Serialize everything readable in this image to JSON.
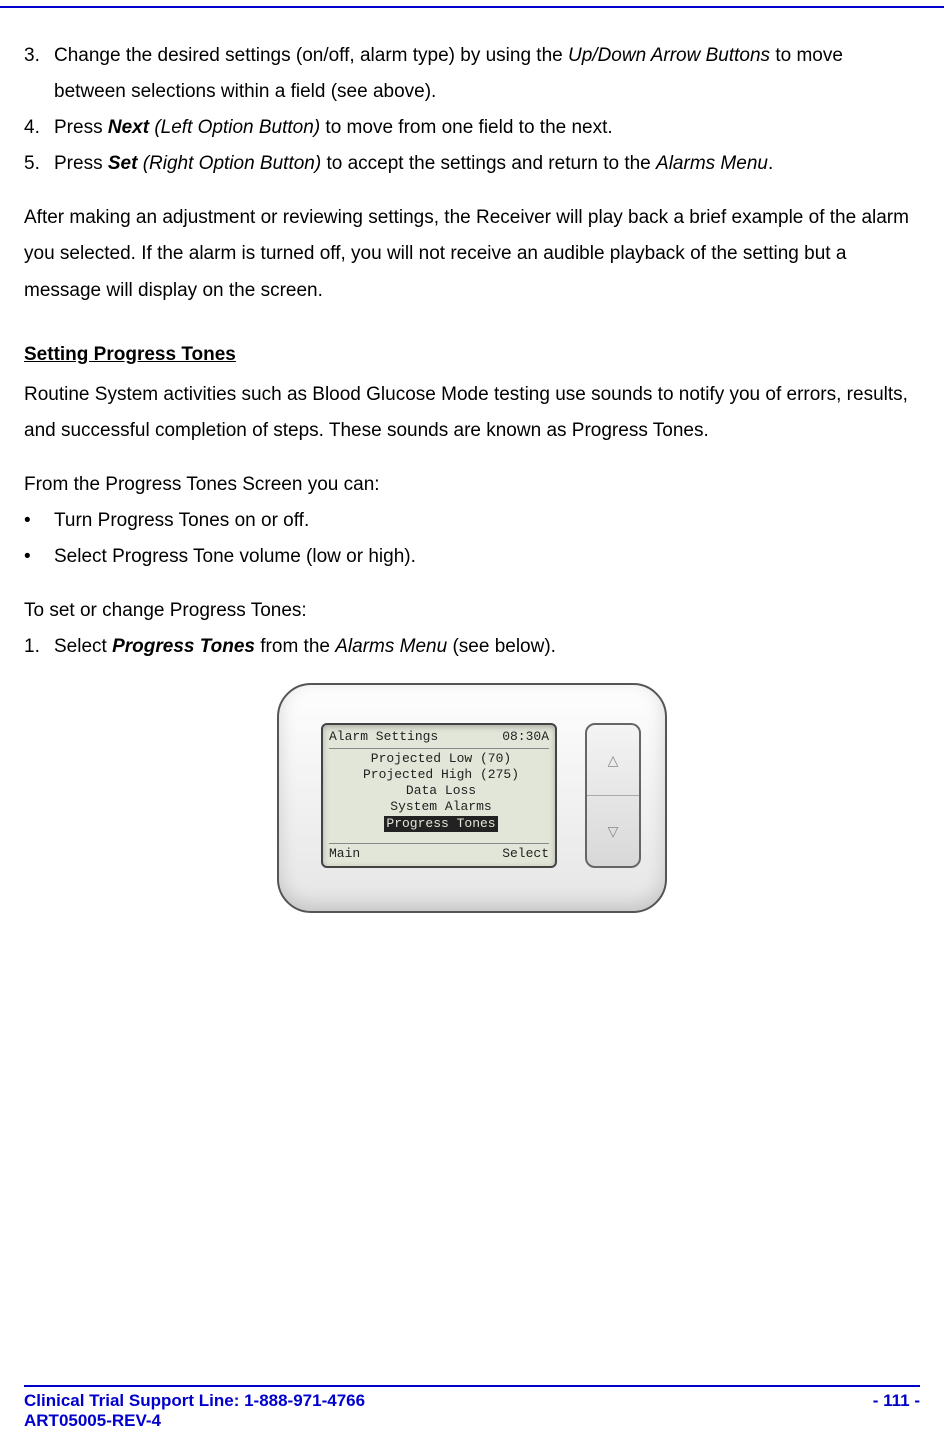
{
  "steps_a": {
    "n3": "3.",
    "n4": "4.",
    "n5": "5.",
    "s3_p1": "Change the desired settings (on/off, alarm type) by using the ",
    "s3_i1": "Up/Down Arrow Buttons",
    "s3_p2": " to move between selections within a field (see above).",
    "s4_p1": "Press ",
    "s4_b1": "Next",
    "s4_i1": " (Left Option Button)",
    "s4_p2": " to move from one field to the next.",
    "s5_p1": "Press ",
    "s5_b1": "Set",
    "s5_i1": " (Right Option Button)",
    "s5_p2": " to accept the settings and return to the ",
    "s5_i2": "Alarms Menu",
    "s5_p3": "."
  },
  "para1": "After making an adjustment or reviewing settings, the Receiver will play back a brief example of the alarm you selected. If the alarm is turned off, you will not receive an audible playback of the setting but a message will display on the screen.",
  "heading": "Setting Progress Tones",
  "para2": "Routine System activities such as Blood Glucose Mode testing use sounds to notify you of errors, results, and successful completion of steps. These sounds are known as Progress Tones.",
  "lead2": "From the Progress Tones Screen you can:",
  "bullet_mark": "•",
  "bullets": {
    "b1": "Turn Progress Tones on or off.",
    "b2": "Select Progress Tone volume (low or high)."
  },
  "lead3": "To set or change Progress Tones:",
  "steps_b": {
    "n1": "1.",
    "s1_p1": "Select ",
    "s1_b1": "Progress Tones",
    "s1_p2": " from the ",
    "s1_i1": "Alarms Menu",
    "s1_p3": " (see below)."
  },
  "device": {
    "screen_title": "Alarm Settings",
    "screen_time": "08:30A",
    "items": {
      "i1": "Projected Low (70)",
      "i2": "Projected High (275)",
      "i3": "Data Loss",
      "i4": "System Alarms",
      "i5": "Progress Tones"
    },
    "soft_left": "Main",
    "soft_right": "Select",
    "up": "△",
    "down": "▽"
  },
  "footer": {
    "line1": "Clinical Trial Support Line:  1-888-971-4766",
    "page": "- 111 -",
    "line2": "ART05005-REV-4"
  }
}
